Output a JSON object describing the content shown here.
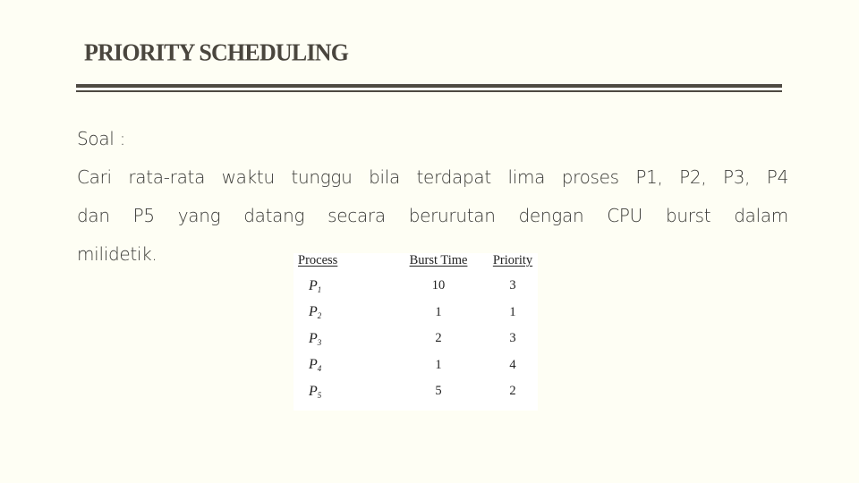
{
  "slide": {
    "title": "PRIORITY SCHEDULING",
    "label": "Soal  :",
    "paragraph": {
      "line1": "Cari rata-rata waktu tunggu bila terdapat lima proses P1, P2, P3, P4",
      "line2": "dan P5  yang datang secara berurutan dengan CPU burst dalam",
      "line3": "milidetik."
    }
  },
  "table": {
    "headers": [
      "Process",
      "Burst Time",
      "Priority"
    ],
    "rows": [
      {
        "process": "P",
        "sub": "1",
        "burst": "10",
        "priority": "3"
      },
      {
        "process": "P",
        "sub": "2",
        "burst": "1",
        "priority": "1"
      },
      {
        "process": "P",
        "sub": "3",
        "burst": "2",
        "priority": "3"
      },
      {
        "process": "P",
        "sub": "4",
        "burst": "1",
        "priority": "4"
      },
      {
        "process": "P",
        "sub": "5",
        "burst": "5",
        "priority": "2"
      }
    ]
  }
}
